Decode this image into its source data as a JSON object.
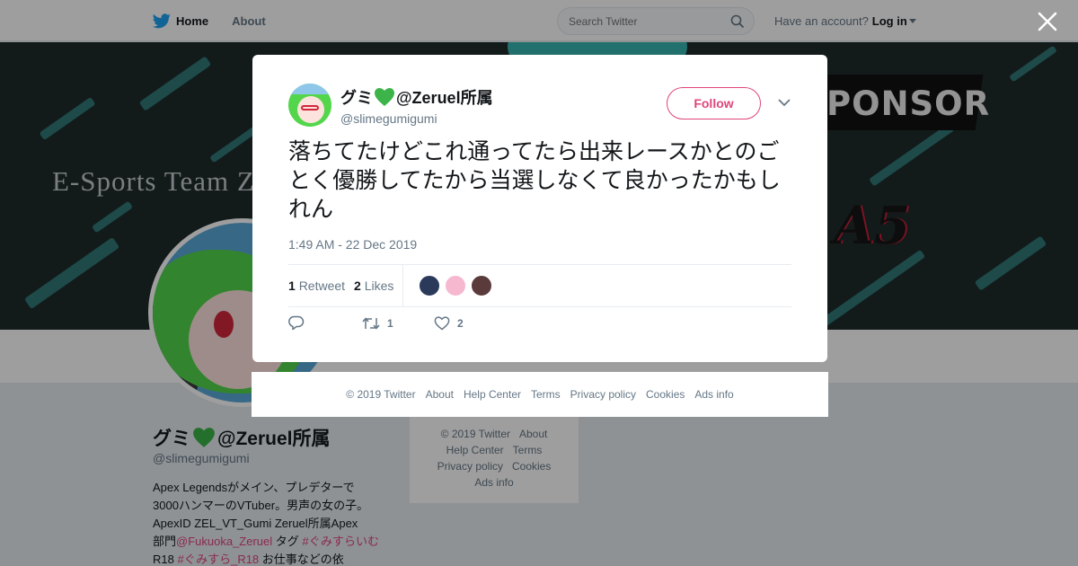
{
  "topbar": {
    "home_label": "Home",
    "about_label": "About",
    "search_placeholder": "Search Twitter",
    "have_account": "Have an account?",
    "login_label": "Log in"
  },
  "banner": {
    "esports_text": "E-Sports Team Z",
    "sponsor_text": "PONSOR",
    "logo_text": "A5"
  },
  "profile": {
    "name": "グミ",
    "name_suffix": "@Zeruel所属",
    "handle": "@slimegumigumi",
    "bio": {
      "line1": "Apex Legendsがメイン、プレデターで",
      "line2": "3000ハンマーのVTuber。男声の女の子。",
      "line3": "ApexID ZEL_VT_Gumi Zeruel所属Apex",
      "line4_prefix": "部門",
      "mention": "@Fukuoka_Zeruel",
      "tag_word": " タグ ",
      "hashtag1": "#ぐみすらいむ",
      "r18": " R18 ",
      "hashtag2": "#ぐみすら_R18",
      "tail": " お仕事などの依"
    }
  },
  "side_footer": {
    "copyright": "© 2019 Twitter",
    "about": "About",
    "help": "Help Center",
    "terms": "Terms",
    "privacy": "Privacy policy",
    "cookies": "Cookies",
    "ads": "Ads info"
  },
  "tweet": {
    "author_name": "グミ",
    "author_name_suffix": "@Zeruel所属",
    "author_handle": "@slimegumigumi",
    "follow_label": "Follow",
    "text": "落ちてたけどこれ通ってたら出来レースかとのごとく優勝してたから当選しなくて良かったかもしれん",
    "time": "1:49 AM - 22 Dec 2019",
    "retweet_count": "1",
    "retweet_label": "Retweet",
    "like_count": "2",
    "like_label": "Likes",
    "action_retweet_count": "1",
    "action_like_count": "2"
  },
  "modal_footer": {
    "copyright": "© 2019 Twitter",
    "about": "About",
    "help": "Help Center",
    "terms": "Terms",
    "privacy": "Privacy policy",
    "cookies": "Cookies",
    "ads": "Ads info"
  },
  "colors": {
    "twitter_blue": "#1da1f2",
    "accent_pink": "#e0457b",
    "heart_green": "#3cb44a",
    "muted_text": "#657786"
  }
}
